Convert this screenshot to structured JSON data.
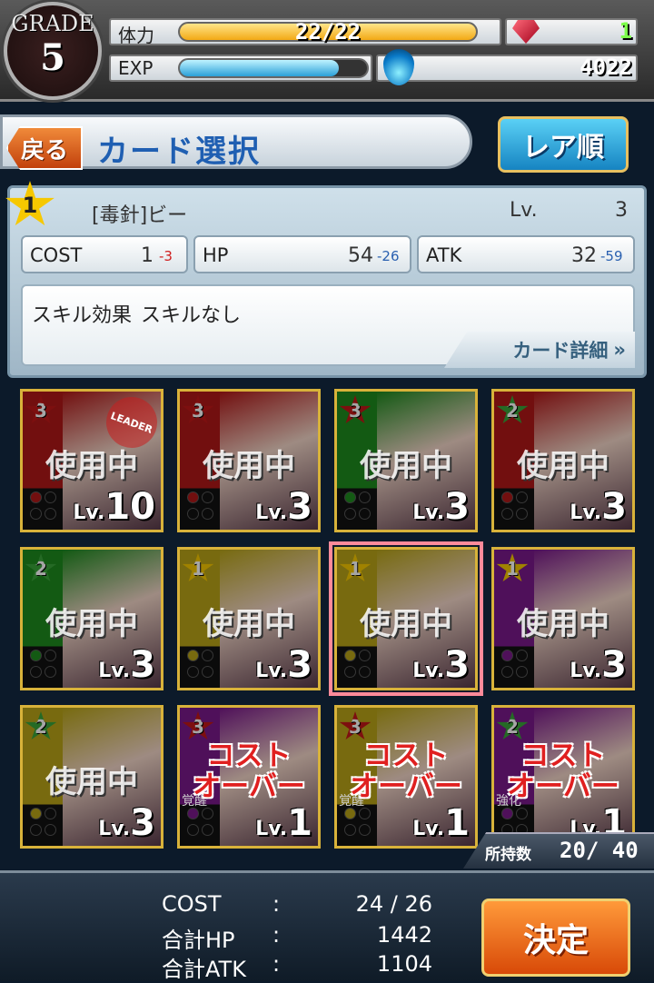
{
  "header": {
    "grade_label": "GRADE",
    "grade_value": "5",
    "stamina_label": "体力",
    "stamina_value": "22/22",
    "stamina_fraction": 1.0,
    "exp_label": "EXP",
    "exp_fraction": 0.85,
    "gems": "1",
    "coins": "4022",
    "icons": [
      "ruby-gem-icon",
      "blue-flame-icon"
    ]
  },
  "titlebar": {
    "back_label": "戻る",
    "title": "カード選択",
    "sort_label": "レア順"
  },
  "selected_card": {
    "rarity": "1",
    "name": "[毒針]ビー",
    "lv_label": "Lv.",
    "lv": "3",
    "cost_label": "COST",
    "cost": "1",
    "cost_mod": "-3",
    "hp_label": "HP",
    "hp": "54",
    "hp_mod": "-26",
    "atk_label": "ATK",
    "atk": "32",
    "atk_mod": "-59",
    "skill_label": "スキル効果",
    "skill": "スキルなし",
    "detail_label": "カード詳細"
  },
  "cards": [
    {
      "rarity": "3",
      "color": "red",
      "lv": "10",
      "status": "使用中",
      "leader": "LEADER"
    },
    {
      "rarity": "3",
      "color": "red",
      "lv": "3",
      "status": "使用中"
    },
    {
      "rarity": "3",
      "color": "green",
      "lv": "3",
      "status": "使用中"
    },
    {
      "rarity": "2",
      "color": "red",
      "lv": "3",
      "status": "使用中"
    },
    {
      "rarity": "2",
      "color": "green",
      "lv": "3",
      "status": "使用中"
    },
    {
      "rarity": "1",
      "color": "yellow",
      "lv": "3",
      "status": "使用中"
    },
    {
      "rarity": "1",
      "color": "yellow",
      "lv": "3",
      "status": "使用中",
      "selected": true
    },
    {
      "rarity": "1",
      "color": "purple",
      "lv": "3",
      "status": "使用中"
    },
    {
      "rarity": "2",
      "color": "yellow",
      "lv": "3",
      "status": "使用中"
    },
    {
      "rarity": "3",
      "color": "purple",
      "lv": "1",
      "status": "コスト オーバー",
      "tag": "覚醒"
    },
    {
      "rarity": "3",
      "color": "yellow",
      "lv": "1",
      "status": "コスト オーバー",
      "tag": "覚醒"
    },
    {
      "rarity": "2",
      "color": "purple",
      "lv": "1",
      "status": "コスト オーバー",
      "tag": "強化"
    }
  ],
  "card_colors": {
    "red": "#b01818",
    "green": "#1e8a1e",
    "yellow": "#b8a418",
    "purple": "#7a1a8a"
  },
  "owned": {
    "label": "所持数",
    "value": "20/ 40"
  },
  "footer": {
    "cost_label": "COST",
    "cost_value": "24 / 26",
    "hp_label": "合計HP",
    "hp_value": "1442",
    "atk_label": "合計ATK",
    "atk_value": "1104",
    "colon": ":",
    "decide_label": "決定"
  }
}
